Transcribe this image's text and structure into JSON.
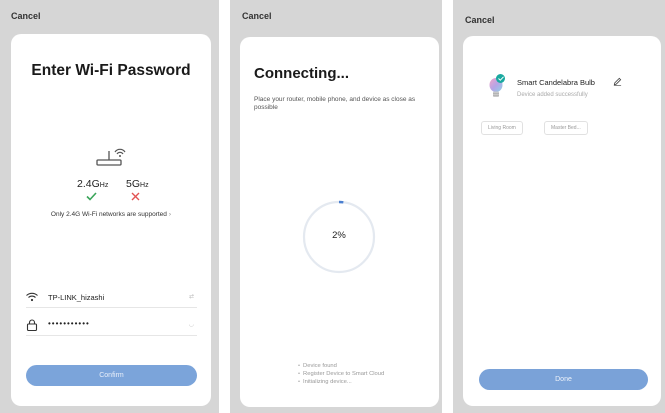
{
  "screen1": {
    "cancel": "Cancel",
    "title": "Enter Wi-Fi Password",
    "band_24": {
      "main": "2.4G",
      "unit": "Hz"
    },
    "band_5": {
      "main": "5G",
      "unit": "Hz"
    },
    "note": "Only 2.4G Wi-Fi networks are supported",
    "note_chevron": "›",
    "ssid": "TP-LINK_hizashi",
    "ssid_action": "⇄",
    "password_masked": "•••••••••••",
    "password_toggle": "◡",
    "confirm": "Confirm",
    "colors": {
      "check": "#3aa55a",
      "cross": "#e25353",
      "button": "#7ba4da"
    }
  },
  "screen2": {
    "cancel": "Cancel",
    "title": "Connecting...",
    "description": "Place your router, mobile phone, and device as close as possible",
    "progress_label": "2%",
    "progress_value": 0.02,
    "steps": [
      "Device found",
      "Register Device to Smart Cloud",
      "Initializing device..."
    ],
    "colors": {
      "ring": "#e4e9f0",
      "ring_active": "#4a7fd0"
    }
  },
  "screen3": {
    "cancel": "Cancel",
    "device_name": "Smart Candelabra Bulb",
    "device_status": "Device added successfully",
    "rooms": [
      "Living Room",
      "Master Bed..."
    ],
    "done": "Done",
    "colors": {
      "badge": "#1aa9a0",
      "button": "#7aa2d8"
    }
  },
  "icons": [
    "router-icon",
    "check-icon",
    "cross-icon",
    "wifi-icon",
    "lock-icon",
    "bulb-icon",
    "success-check-icon",
    "edit-icon"
  ]
}
